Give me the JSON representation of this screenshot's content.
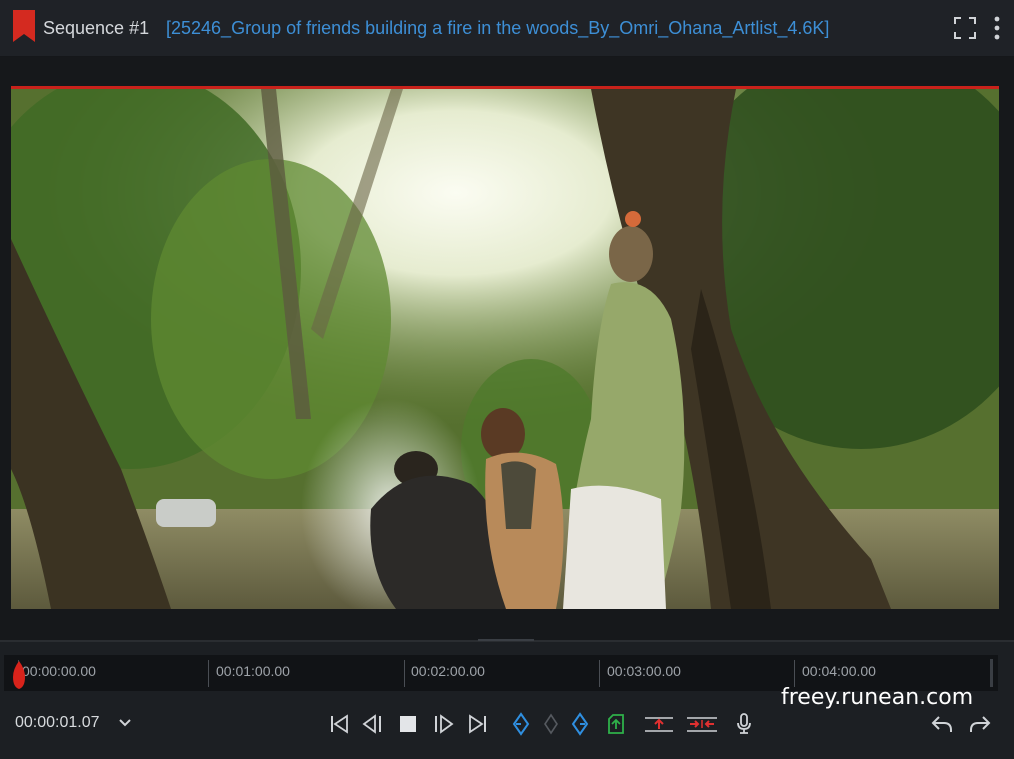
{
  "header": {
    "sequence_title": "Sequence #1",
    "clip_title": "[25246_Group of friends building a fire in the woods_By_Omri_Ohana_Artlist_4.6K]"
  },
  "icons": {
    "bookmark": "bookmark-icon",
    "fullscreen": "fullscreen-icon",
    "more": "more-vertical-icon"
  },
  "timeline": {
    "ticks": [
      "00:00:00.00",
      "00:01:00.00",
      "00:02:00.00",
      "00:03:00.00",
      "00:04:00.00"
    ]
  },
  "transport": {
    "current_time": "00:00:01.07"
  },
  "watermark": "freey.runean.com",
  "colors": {
    "accent_red": "#c8221b",
    "title_blue": "#3d8fd6",
    "marker_blue": "#2f8fe0",
    "marker_green": "#2fb14a",
    "background": "#1c1f23"
  }
}
